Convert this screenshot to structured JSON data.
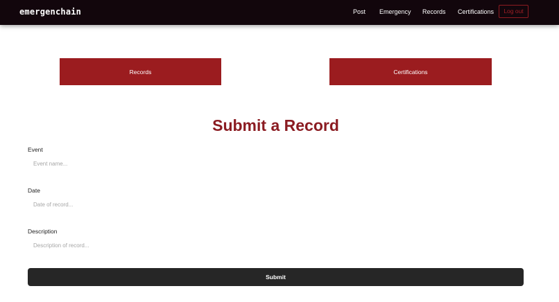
{
  "nav": {
    "brand": "emergenchain",
    "links": [
      "Post",
      "Emergency",
      "Records",
      "Certifications"
    ],
    "logout_label": "Log out"
  },
  "top_buttons": {
    "records_label": "Records",
    "certifications_label": "Certifications"
  },
  "form": {
    "title": "Submit a Record",
    "fields": [
      {
        "label": "Event",
        "placeholder": "Event name...",
        "value": ""
      },
      {
        "label": "Date",
        "placeholder": "Date of record...",
        "value": ""
      },
      {
        "label": "Description",
        "placeholder": "Description of record...",
        "value": ""
      }
    ],
    "submit_label": "Submit"
  },
  "colors": {
    "navbar": "#12060c",
    "accent": "#9b1c1f",
    "title": "#8b1c22",
    "submit": "#262626"
  }
}
